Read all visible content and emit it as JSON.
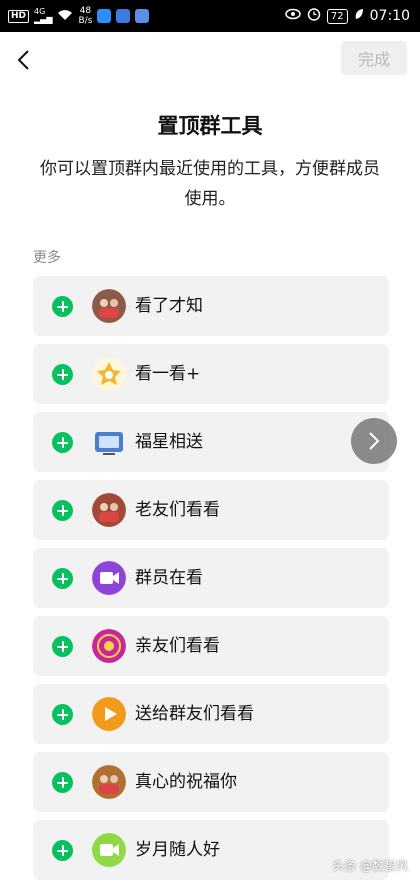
{
  "status_bar": {
    "hd": "HD",
    "network": "4G",
    "speed_value": "48",
    "speed_unit": "B/s",
    "battery": "72",
    "time": "07:10"
  },
  "header": {
    "done_label": "完成"
  },
  "page": {
    "title": "置顶群工具",
    "description": "你可以置顶群内最近使用的工具，方便群成员使用。",
    "section_label": "更多"
  },
  "tools": [
    {
      "name": "看了才知",
      "icon": "photo-avatar-icon",
      "color": "#8a5a4a"
    },
    {
      "name": "看一看+",
      "icon": "star-badge-icon",
      "color": "#f2b632"
    },
    {
      "name": "福星相送",
      "icon": "tv-icon",
      "color": "#4a7fd0"
    },
    {
      "name": "老友们看看",
      "icon": "photo-avatar-icon",
      "color": "#a04a3a"
    },
    {
      "name": "群员在看",
      "icon": "video-camera-icon",
      "color": "#8e44d6"
    },
    {
      "name": "亲友们看看",
      "icon": "badge-icon",
      "color": "#c8279a"
    },
    {
      "name": "送给群友们看看",
      "icon": "play-icon",
      "color": "#f29a1a"
    },
    {
      "name": "真心的祝福你",
      "icon": "photo-avatar-icon",
      "color": "#b07030"
    },
    {
      "name": "岁月随人好",
      "icon": "video-camera-icon",
      "color": "#8fd846"
    }
  ],
  "watermark": "头条 @数智风",
  "colors": {
    "accent": "#07c160",
    "item_bg": "#f2f2f2"
  }
}
